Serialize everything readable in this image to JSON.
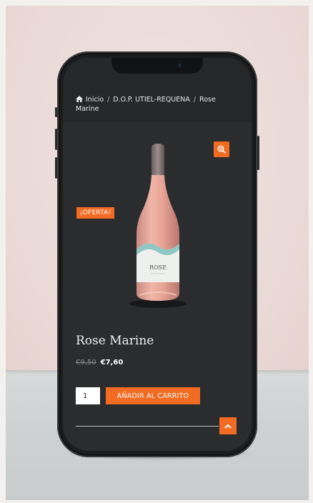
{
  "breadcrumb": {
    "home": "Inicio",
    "separator": "/",
    "category": "D.O.P. UTIEL-REQUENA",
    "current": "Rose Marine"
  },
  "product": {
    "sale_badge": "¡OFERTA!",
    "title": "Rose Marine",
    "old_price": "€9,50",
    "new_price": "€7,60",
    "label_text": "ROSE"
  },
  "cart": {
    "quantity": "1",
    "add_label": "AÑADIR AL CARRITO"
  },
  "icons": {
    "home": "home-icon",
    "zoom": "zoom-in-icon",
    "back_to_top": "chevron-up-icon"
  },
  "colors": {
    "accent": "#f26b22",
    "screen_bg": "#2b2c2e"
  }
}
